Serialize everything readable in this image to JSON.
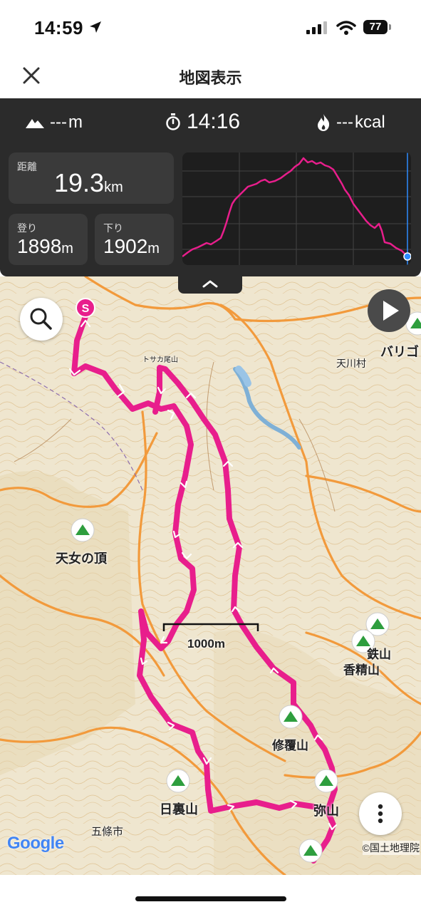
{
  "status_bar": {
    "time": "14:59",
    "battery": "77"
  },
  "nav": {
    "title": "地図表示"
  },
  "stats": {
    "elevation": {
      "value": "---",
      "unit": "m"
    },
    "duration": {
      "value": "14:16"
    },
    "calories": {
      "value": "---",
      "unit": "kcal"
    },
    "distance": {
      "label": "距離",
      "value": "19.3",
      "unit": "km"
    },
    "ascent": {
      "label": "登り",
      "value": "1898",
      "unit": "m"
    },
    "descent": {
      "label": "下り",
      "value": "1902",
      "unit": "m"
    }
  },
  "map": {
    "scale_label": "1000m",
    "labels": {
      "tenkawa": "天川村",
      "barigo": "バリゴ",
      "tennyo": "天女の頂",
      "tetsu": "鉄山",
      "kosei": "香精山",
      "shufuku": "修覆山",
      "yasen": "弥山",
      "hiura": "日裏山",
      "gojo": "五條市",
      "tosaka": "トサカ尾山"
    },
    "start_marker": "S",
    "google_logo": "Google",
    "attribution": "©国土地理院"
  },
  "colors": {
    "track": "#e81e8c",
    "accent": "#2d8cff",
    "panel": "#2b2b2b",
    "peak": "#2e9e3e"
  }
}
